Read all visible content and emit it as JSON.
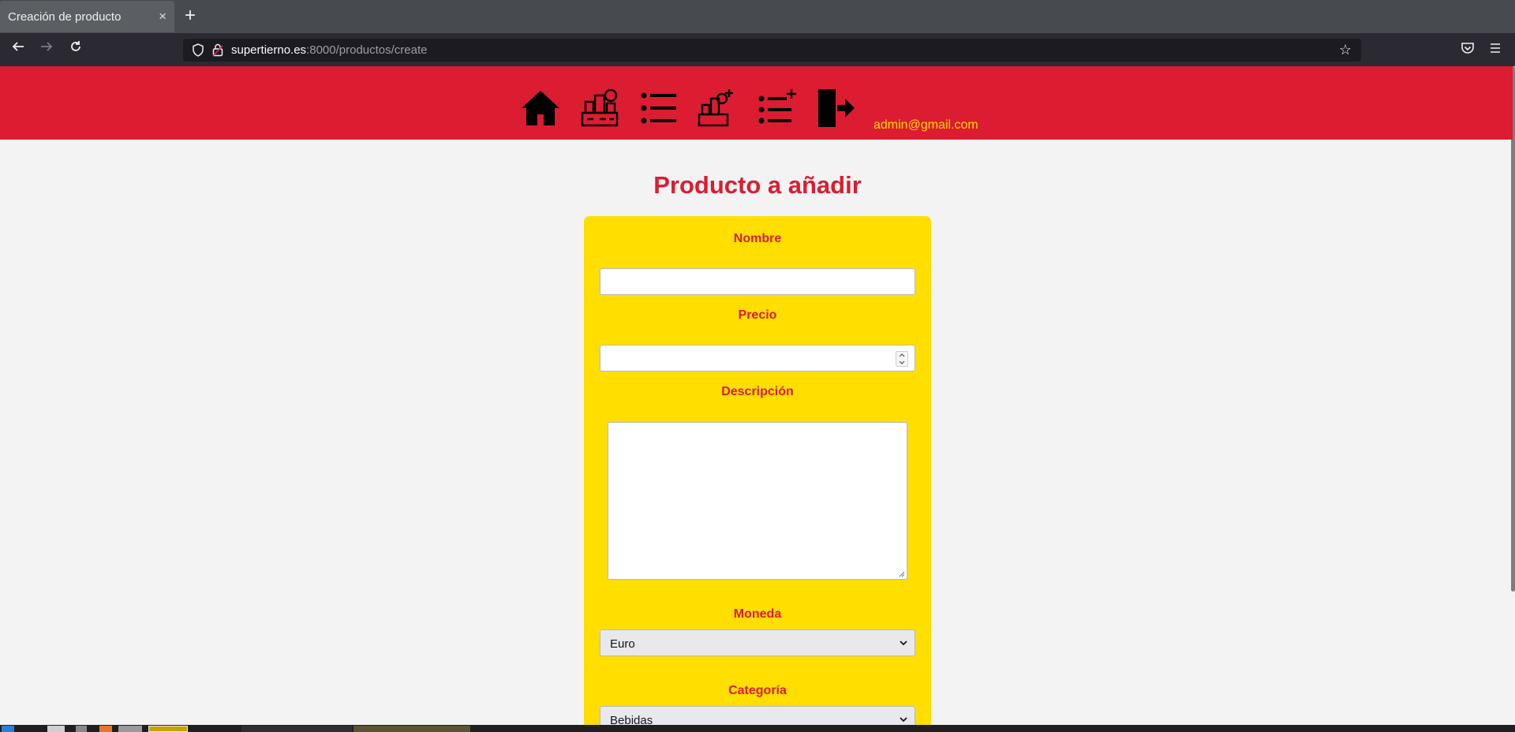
{
  "browser": {
    "tab_title": "Creación de producto",
    "tab_close": "×",
    "new_tab": "+",
    "url_host": "supertierno.es",
    "url_path": ":8000/productos/create"
  },
  "header": {
    "nav_icons": [
      "home-icon",
      "products-icon",
      "list-icon",
      "add-product-icon",
      "add-list-icon",
      "logout-icon"
    ],
    "user_email": "admin@gmail.com"
  },
  "form": {
    "title": "Producto a añadir",
    "nombre_label": "Nombre",
    "nombre_value": "",
    "precio_label": "Precio",
    "precio_value": "",
    "descripcion_label": "Descripción",
    "descripcion_value": "",
    "moneda_label": "Moneda",
    "moneda_selected": "Euro",
    "categoria_label": "Categoría",
    "categoria_selected": "Bebidas"
  },
  "colors": {
    "header_red": "#dc1c31",
    "card_yellow": "#ffde00",
    "email_yellow": "#ffd700"
  }
}
